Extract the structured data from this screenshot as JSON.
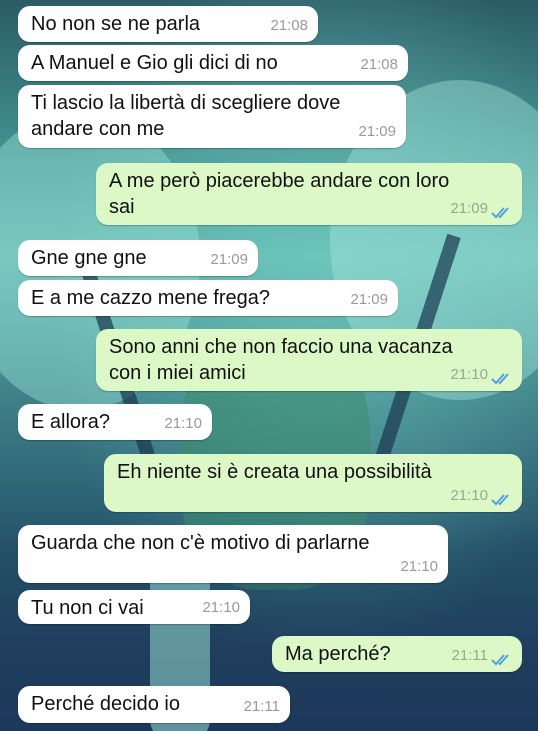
{
  "messages": [
    {
      "text": "No non se ne parla",
      "time": "21:08",
      "direction": "incoming"
    },
    {
      "text": "A Manuel e Gio gli dici di no",
      "time": "21:08",
      "direction": "incoming"
    },
    {
      "text": "Ti lascio la libertà di scegliere dove\nandare con me",
      "time": "21:09",
      "direction": "incoming"
    },
    {
      "text": "A me però piacerebbe andare con loro\nsai",
      "time": "21:09",
      "direction": "outgoing",
      "status": "read"
    },
    {
      "text": "Gne gne gne",
      "time": "21:09",
      "direction": "incoming"
    },
    {
      "text": "E a me cazzo mene frega?",
      "time": "21:09",
      "direction": "incoming"
    },
    {
      "text": "Sono anni che non faccio una vacanza\ncon i miei amici",
      "time": "21:10",
      "direction": "outgoing",
      "status": "read"
    },
    {
      "text": "E allora?",
      "time": "21:10",
      "direction": "incoming"
    },
    {
      "text": "Eh niente si è creata una possibilità",
      "time": "21:10",
      "direction": "outgoing",
      "status": "read"
    },
    {
      "text": "Guarda che non c'è motivo di parlarne",
      "time": "21:10",
      "direction": "incoming"
    },
    {
      "text": "Tu non ci vai",
      "time": "21:10",
      "direction": "incoming"
    },
    {
      "text": "Ma perché?",
      "time": "21:11",
      "direction": "outgoing",
      "status": "read"
    },
    {
      "text": "Perché decido io",
      "time": "21:11",
      "direction": "incoming"
    }
  ],
  "colors": {
    "incoming_bubble": "#ffffff",
    "outgoing_bubble": "#dcf8c6",
    "read_ticks": "#4fa3e0"
  },
  "icons": {
    "read_status": "double-check-icon"
  }
}
